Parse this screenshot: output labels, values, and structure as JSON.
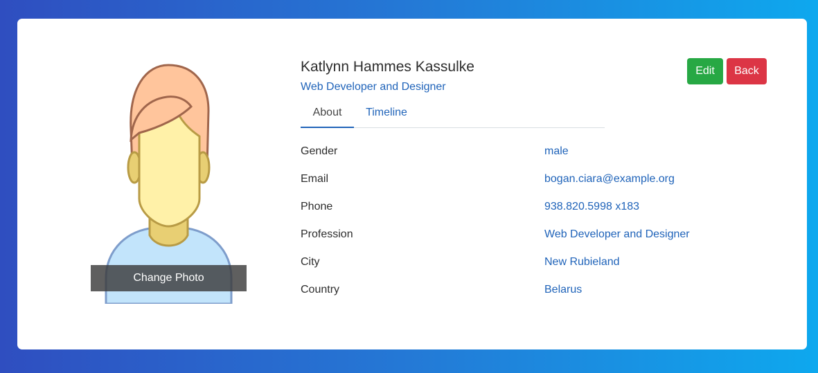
{
  "profile": {
    "name": "Katlynn Hammes Kassulke",
    "title": "Web Developer and Designer",
    "change_photo_label": "Change Photo"
  },
  "actions": {
    "edit_label": "Edit",
    "back_label": "Back"
  },
  "tabs": [
    {
      "label": "About",
      "active": true
    },
    {
      "label": "Timeline",
      "active": false
    }
  ],
  "details": [
    {
      "label": "Gender",
      "value": "male"
    },
    {
      "label": "Email",
      "value": "bogan.ciara@example.org"
    },
    {
      "label": "Phone",
      "value": "938.820.5998 x183"
    },
    {
      "label": "Profession",
      "value": "Web Developer and Designer"
    },
    {
      "label": "City",
      "value": "New Rubieland"
    },
    {
      "label": "Country",
      "value": "Belarus"
    }
  ],
  "colors": {
    "accent": "#1f63b9",
    "edit": "#27a844",
    "back": "#dc3545"
  },
  "icons": {
    "avatar": "user-avatar-icon"
  }
}
